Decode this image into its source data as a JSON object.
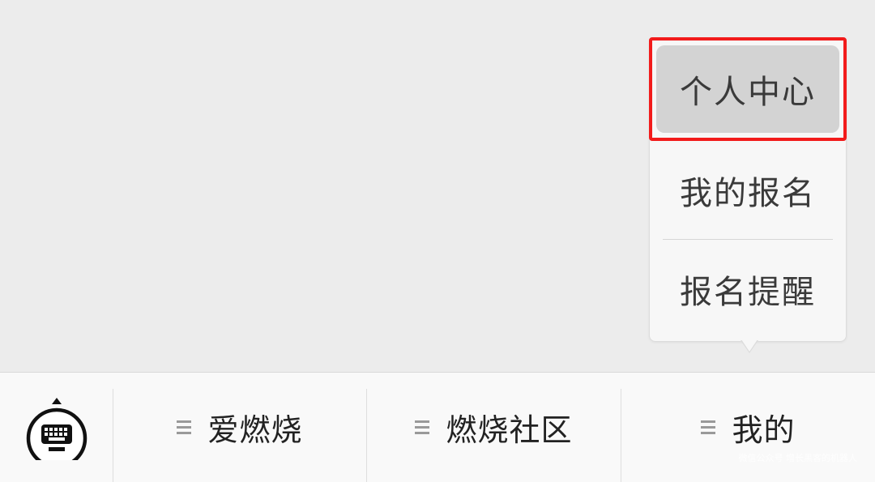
{
  "menu": {
    "items": [
      {
        "label": "个人中心",
        "highlighted": true
      },
      {
        "label": "我的报名",
        "highlighted": false
      },
      {
        "label": "报名提醒",
        "highlighted": false
      }
    ]
  },
  "bottom_bar": {
    "keyboard_icon": "keyboard-icon",
    "tabs": [
      {
        "label": "爱燃烧",
        "icon": "menu-lines-icon"
      },
      {
        "label": "燃烧社区",
        "icon": "menu-lines-icon"
      },
      {
        "label": "我的",
        "icon": "menu-lines-icon"
      }
    ]
  },
  "watermark": "微信公众号 增长黑客的机器人",
  "colors": {
    "highlight_border": "#f21b1b",
    "selected_item_bg": "#d3d3d3",
    "background": "#ececec"
  }
}
